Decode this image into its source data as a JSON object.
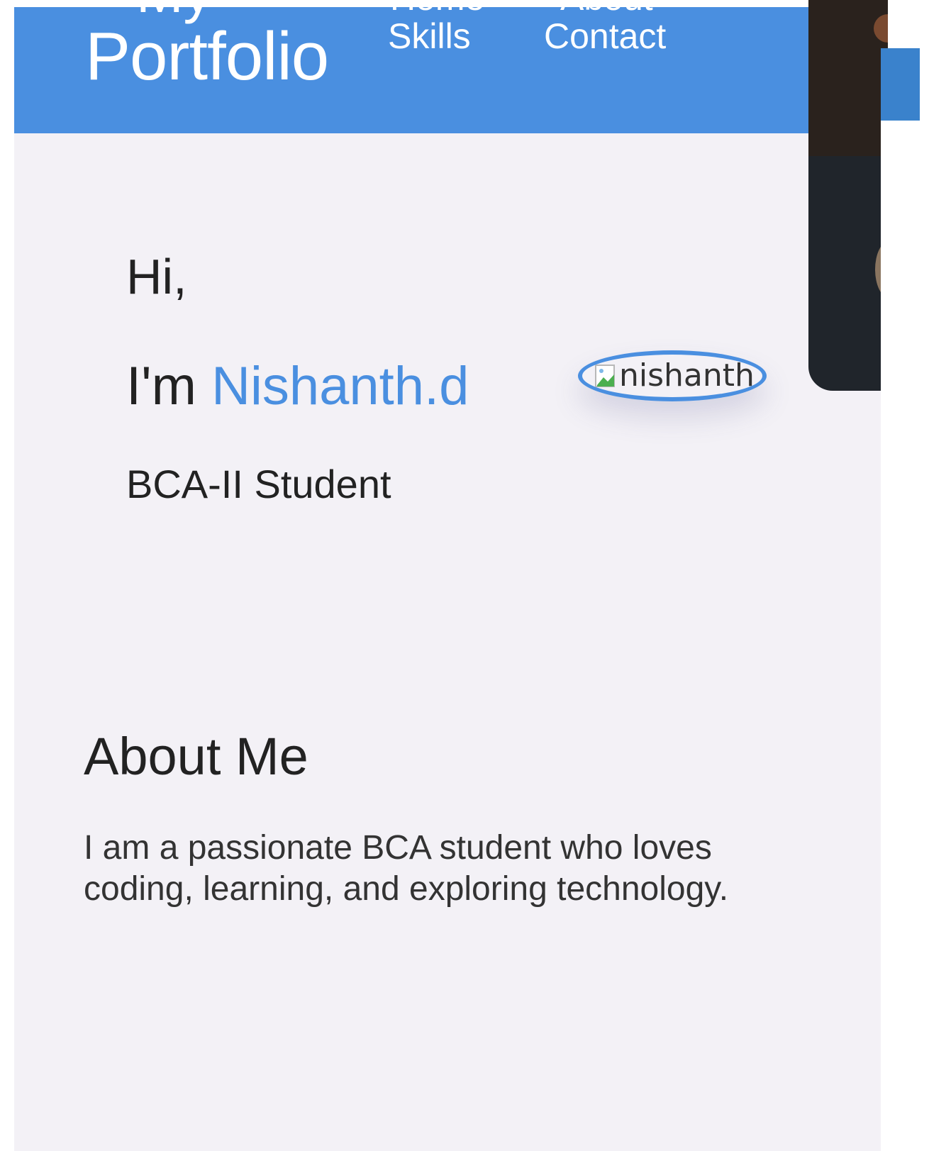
{
  "navbar": {
    "brand_top": "My",
    "brand": "Portfolio",
    "links": [
      {
        "label": "Home"
      },
      {
        "label": "About"
      },
      {
        "label": "Skills"
      },
      {
        "label": "Contact"
      }
    ]
  },
  "hero": {
    "greeting": "Hi,",
    "intro": "I'm",
    "name": "Nishanth.d",
    "role": "BCA-II Student",
    "avatar_alt": "nishanth"
  },
  "about": {
    "title": "About Me",
    "text": "I am a passionate BCA student who loves coding, learning, and exploring technology."
  },
  "colors": {
    "accent": "#4a8fe0",
    "background": "#f3f1f6",
    "text": "#222222"
  }
}
